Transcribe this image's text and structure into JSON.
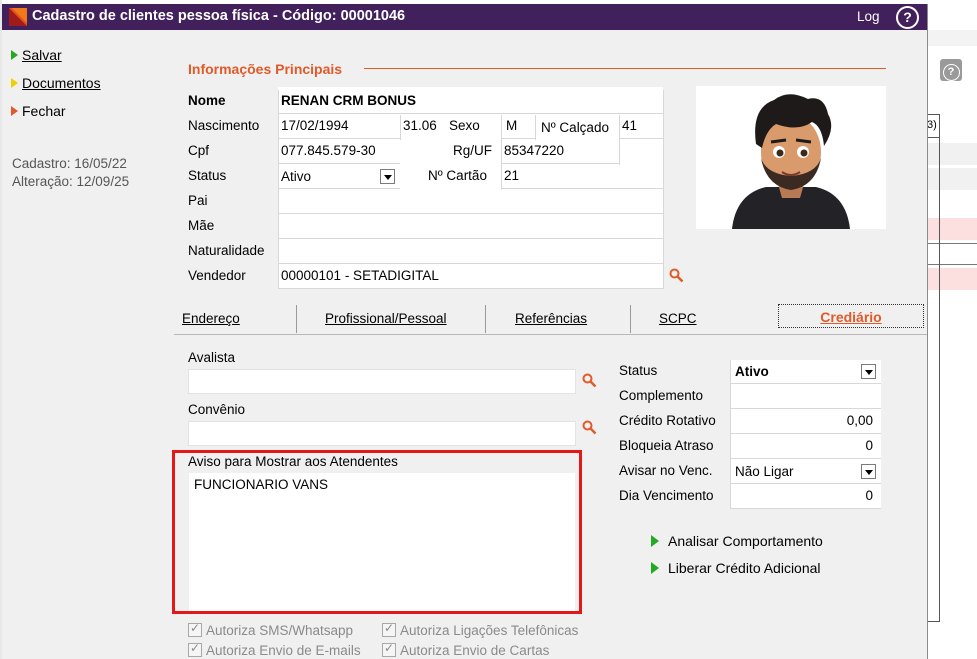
{
  "window": {
    "title": "Cadastro de clientes pessoa física - Código: 00001046",
    "log_label": "Log",
    "help_glyph": "?"
  },
  "sidebar": {
    "actions": [
      {
        "label": "Salvar",
        "accent": "#22aa22"
      },
      {
        "label": "Documentos",
        "accent": "#f0d000"
      },
      {
        "label": "Fechar",
        "accent": "#e05a2a"
      }
    ],
    "cadastro": "Cadastro: 16/05/22",
    "alteracao": "Alteração: 12/09/25"
  },
  "info": {
    "section_title": "Informações Principais",
    "nome_label": "Nome",
    "nome": "RENAN CRM BONUS",
    "nascimento_label": "Nascimento",
    "nascimento": "17/02/1994",
    "idade": "31.06",
    "sexo_label": "Sexo",
    "sexo": "M",
    "calcado_label": "Nº Calçado",
    "calcado": "41",
    "cpf_label": "Cpf",
    "cpf": "077.845.579-30",
    "rg_label": "Rg/UF",
    "rg": "85347220",
    "status_label": "Status",
    "status": "Ativo",
    "cartao_label": "Nº Cartão",
    "cartao": "21",
    "pai_label": "Pai",
    "pai": "",
    "mae_label": "Mãe",
    "mae": "",
    "naturalidade_label": "Naturalidade",
    "naturalidade": "",
    "vendedor_label": "Vendedor",
    "vendedor": "00000101 - SETADIGITAL"
  },
  "tabs": [
    {
      "label": "Endereço",
      "active": false
    },
    {
      "label": "Profissional/Pessoal",
      "active": false
    },
    {
      "label": "Referências",
      "active": false
    },
    {
      "label": "SCPC",
      "active": false
    },
    {
      "label": "Crediário",
      "active": true
    }
  ],
  "crediario": {
    "avalista_label": "Avalista",
    "avalista": "",
    "convenio_label": "Convênio",
    "convenio": "",
    "aviso_label": "Aviso para Mostrar aos Atendentes",
    "aviso": "FUNCIONARIO VANS",
    "status_label": "Status",
    "status": "Ativo",
    "complemento_label": "Complemento",
    "complemento": "",
    "credito_label": "Crédito Rotativo",
    "credito": "0,00",
    "bloqueia_label": "Bloqueia Atraso",
    "bloqueia": "0",
    "avisar_label": "Avisar no Venc.",
    "avisar": "Não Ligar",
    "dia_label": "Dia Vencimento",
    "dia": "0",
    "analisar": "Analisar Comportamento",
    "liberar": "Liberar Crédito Adicional",
    "checks": [
      {
        "label": "Autoriza SMS/Whatsapp",
        "checked": true
      },
      {
        "label": "Autoriza Ligações Telefônicas",
        "checked": true
      },
      {
        "label": "Autoriza Envio de E-mails",
        "checked": true
      },
      {
        "label": "Autoriza Envio de Cartas",
        "checked": true
      }
    ]
  },
  "background": {
    "help_glyph": "?",
    "fragment": "3)"
  }
}
